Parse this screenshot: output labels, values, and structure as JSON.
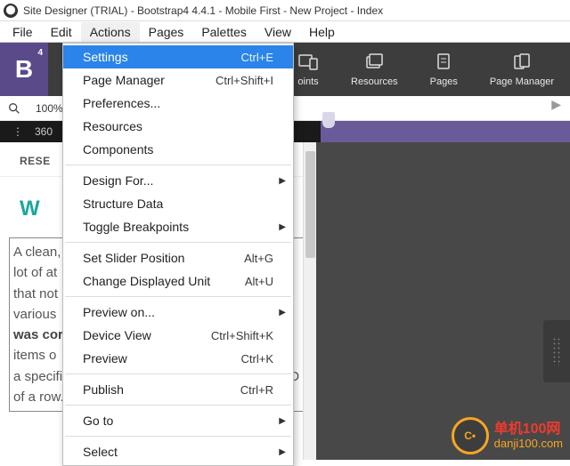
{
  "title": "Site Designer (TRIAL) - Bootstrap4 4.4.1 - Mobile First - New Project - Index",
  "menubar": [
    "File",
    "Edit",
    "Actions",
    "Pages",
    "Palettes",
    "View",
    "Help"
  ],
  "open_menu_index": 2,
  "dropdown": {
    "groups": [
      [
        {
          "label": "Settings",
          "shortcut": "Ctrl+E",
          "highlight": true
        },
        {
          "label": "Page Manager",
          "shortcut": "Ctrl+Shift+I"
        },
        {
          "label": "Preferences..."
        },
        {
          "label": "Resources"
        },
        {
          "label": "Components"
        }
      ],
      [
        {
          "label": "Design For...",
          "submenu": true
        },
        {
          "label": "Structure Data"
        },
        {
          "label": "Toggle Breakpoints",
          "submenu": true
        }
      ],
      [
        {
          "label": "Set Slider Position",
          "shortcut": "Alt+G"
        },
        {
          "label": "Change Displayed Unit",
          "shortcut": "Alt+U"
        }
      ],
      [
        {
          "label": "Preview on...",
          "submenu": true
        },
        {
          "label": "Device View",
          "shortcut": "Ctrl+Shift+K"
        },
        {
          "label": "Preview",
          "shortcut": "Ctrl+K"
        }
      ],
      [
        {
          "label": "Publish",
          "shortcut": "Ctrl+R"
        }
      ],
      [
        {
          "label": "Go to",
          "submenu": true
        }
      ],
      [
        {
          "label": "Select",
          "submenu": true
        }
      ]
    ]
  },
  "brand": {
    "letter": "B",
    "sup": "4"
  },
  "toolbar_partial_label": "oints",
  "toolbar_buttons": [
    {
      "name": "resources",
      "label": "Resources"
    },
    {
      "name": "pages",
      "label": "Pages"
    },
    {
      "name": "page-manager",
      "label": "Page Manager"
    }
  ],
  "zoom": "100%",
  "width_value": "360",
  "canvas": {
    "tab_partial": "RESE",
    "heading_partial": "W",
    "body_html": "A clean,<br>lot of at<br>that not<br>various<br><b>was cor</b><br>items o<br>a specific section of the page by linking to the ID of a row. A small Javascript snippet pasted"
  },
  "watermark": {
    "line1": "单机100网",
    "line2": "danji100.com",
    "icon_text": "C•"
  }
}
